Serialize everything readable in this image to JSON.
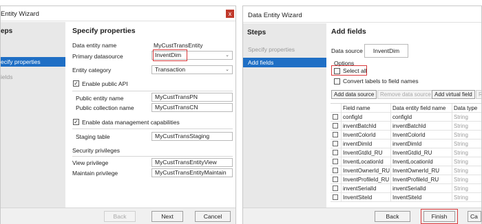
{
  "left_dialog": {
    "title": "Entity Wizard",
    "close_glyph": "x",
    "sidebar": {
      "title": "eps",
      "items": [
        "ecify properties",
        "ields"
      ]
    },
    "heading": "Specify properties",
    "fields": {
      "entity_name_label": "Data entity name",
      "entity_name_value": "MyCustTransEntity",
      "primary_ds_label": "Primary datasource",
      "primary_ds_value": "InventDim",
      "category_label": "Entity category",
      "category_value": "Transaction",
      "enable_api_label": "Enable public API",
      "public_entity_label": "Public entity name",
      "public_entity_value": "MyCustTransPN",
      "public_collection_label": "Public collection name",
      "public_collection_value": "MyCustTransCN",
      "enable_dm_label": "Enable data management capabilities",
      "staging_label": "Staging table",
      "staging_value": "MyCustTransStaging",
      "security_label": "Security privileges",
      "view_priv_label": "View privilege",
      "view_priv_value": "MyCustTransEntityView",
      "maintain_priv_label": "Maintain privilege",
      "maintain_priv_value": "MyCustTransEntityMaintain"
    },
    "footer": {
      "back": "Back",
      "next": "Next",
      "cancel": "Cancel"
    }
  },
  "right_dialog": {
    "title": "Data Entity Wizard",
    "sidebar": {
      "title": "Steps",
      "items": [
        "Specify properties",
        "Add fields"
      ]
    },
    "heading": "Add fields",
    "datasource_label": "Data source",
    "datasource_value": "InventDim",
    "options_label": "Options",
    "select_all_label": "Select all",
    "convert_label": "Convert labels to field names",
    "toolbar": {
      "add_ds": "Add data source",
      "remove_ds": "Remove data source",
      "add_virtual": "Add virtual field",
      "extra": "R"
    },
    "grid": {
      "columns": [
        "Field name",
        "Data entity field name",
        "Data type"
      ],
      "rows": [
        [
          "configId",
          "configId",
          "String"
        ],
        [
          "inventBatchId",
          "inventBatchId",
          "String"
        ],
        [
          "InventColorId",
          "InventColorId",
          "String"
        ],
        [
          "inventDimId",
          "inventDimId",
          "String"
        ],
        [
          "InventGtdId_RU",
          "InventGtdId_RU",
          "String"
        ],
        [
          "InventLocationId",
          "InventLocationId",
          "String"
        ],
        [
          "InventOwnerId_RU",
          "InventOwnerId_RU",
          "String"
        ],
        [
          "InventProfileId_RU",
          "InventProfileId_RU",
          "String"
        ],
        [
          "inventSerialId",
          "inventSerialId",
          "String"
        ],
        [
          "InventSiteId",
          "InventSiteId",
          "String"
        ]
      ]
    },
    "footer": {
      "back": "Back",
      "finish": "Finish",
      "cancel": "Ca"
    }
  }
}
